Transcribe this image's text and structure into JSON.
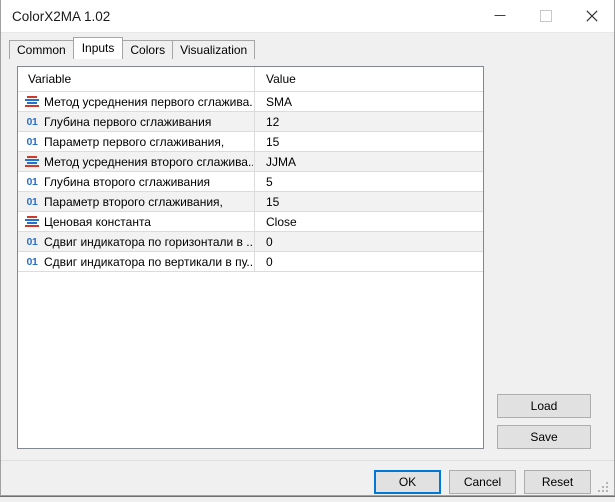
{
  "window": {
    "title": "ColorX2MA 1.02",
    "caption_buttons": [
      {
        "name": "minimize",
        "label": "—"
      },
      {
        "name": "maximize",
        "label": "□"
      },
      {
        "name": "close",
        "label": "✕"
      }
    ]
  },
  "tabs": [
    {
      "label": "Common",
      "selected": false
    },
    {
      "label": "Inputs",
      "selected": true
    },
    {
      "label": "Colors",
      "selected": false
    },
    {
      "label": "Visualization",
      "selected": false
    }
  ],
  "table": {
    "columns": [
      "Variable",
      "Value"
    ],
    "rows": [
      {
        "icon": "enum-icon",
        "variable": "Метод усреднения первого сглажива...",
        "value": "SMA"
      },
      {
        "icon": "integer-icon",
        "variable": "Глубина  первого сглаживания",
        "value": "12"
      },
      {
        "icon": "integer-icon",
        "variable": "Параметр первого сглаживания,",
        "value": "15"
      },
      {
        "icon": "enum-icon",
        "variable": "Метод усреднения второго сглажива...",
        "value": "JJMA"
      },
      {
        "icon": "integer-icon",
        "variable": "Глубина  второго сглаживания",
        "value": "5"
      },
      {
        "icon": "integer-icon",
        "variable": "Параметр второго сглаживания,",
        "value": "15"
      },
      {
        "icon": "enum-icon",
        "variable": "Ценовая константа",
        "value": "Close"
      },
      {
        "icon": "integer-icon",
        "variable": "Сдвиг индикатора по горизонтали в ...",
        "value": "0"
      },
      {
        "icon": "integer-icon",
        "variable": "Сдвиг индикатора по вертикали в пу...",
        "value": "0"
      }
    ]
  },
  "side_buttons": {
    "load": "Load",
    "save": "Save"
  },
  "footer_buttons": {
    "ok": "OK",
    "cancel": "Cancel",
    "reset": "Reset"
  },
  "icon_labels": {
    "integer": "01"
  },
  "colors": {
    "accent": "#0078d7",
    "icon_blue": "#2a6fc9",
    "icon_red": "#cf3a2f",
    "dialog_bg": "#f0f0f0",
    "row_alt_bg": "#f2f2f2"
  }
}
